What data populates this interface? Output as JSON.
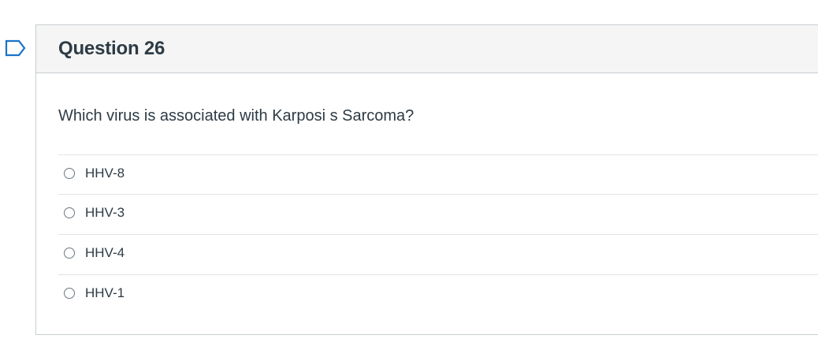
{
  "question": {
    "title": "Question 26",
    "text": "Which virus is associated with Karposi s Sarcoma?"
  },
  "answers": [
    {
      "label": "HHV-8"
    },
    {
      "label": "HHV-3"
    },
    {
      "label": "HHV-4"
    },
    {
      "label": "HHV-1"
    }
  ],
  "icons": {
    "flag": "flag-icon"
  },
  "colors": {
    "flag": "#1a73c9",
    "header_bg": "#f5f5f5",
    "border": "#c7cdd1",
    "text": "#2d3b45"
  }
}
